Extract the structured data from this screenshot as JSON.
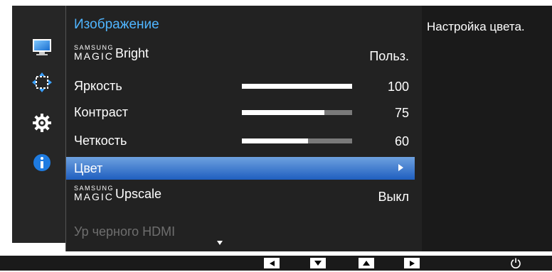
{
  "menu": {
    "title": "Изображение",
    "items": [
      {
        "samsung": "SAMSUNG",
        "magic": "MAGIC",
        "label": "Bright",
        "value": "Польз."
      },
      {
        "label": "Яркость",
        "value": "100",
        "level": 100
      },
      {
        "label": "Контраст",
        "value": "75",
        "level": 75
      },
      {
        "label": "Четкость",
        "value": "60",
        "level": 60
      },
      {
        "label": "Цвет",
        "selected": true
      },
      {
        "samsung": "SAMSUNG",
        "magic": "MAGIC",
        "label": "Upscale",
        "value": "Выкл"
      },
      {
        "label": "Ур черного HDMI",
        "disabled": true
      }
    ]
  },
  "help": {
    "text": "Настройка цвета."
  },
  "left_icons": [
    "monitor-icon",
    "move-arrows-icon",
    "gear-icon",
    "info-icon"
  ],
  "bottom_keys": [
    "left-arrow-key",
    "down-arrow-key",
    "up-arrow-key",
    "right-arrow-key",
    "power-icon"
  ],
  "colors": {
    "accent_title": "#4fb5ff",
    "selection": "#2d6fcc",
    "panel": "#222222",
    "slider_track": "#7a7a7a",
    "slider_fill": "#ffffff"
  }
}
